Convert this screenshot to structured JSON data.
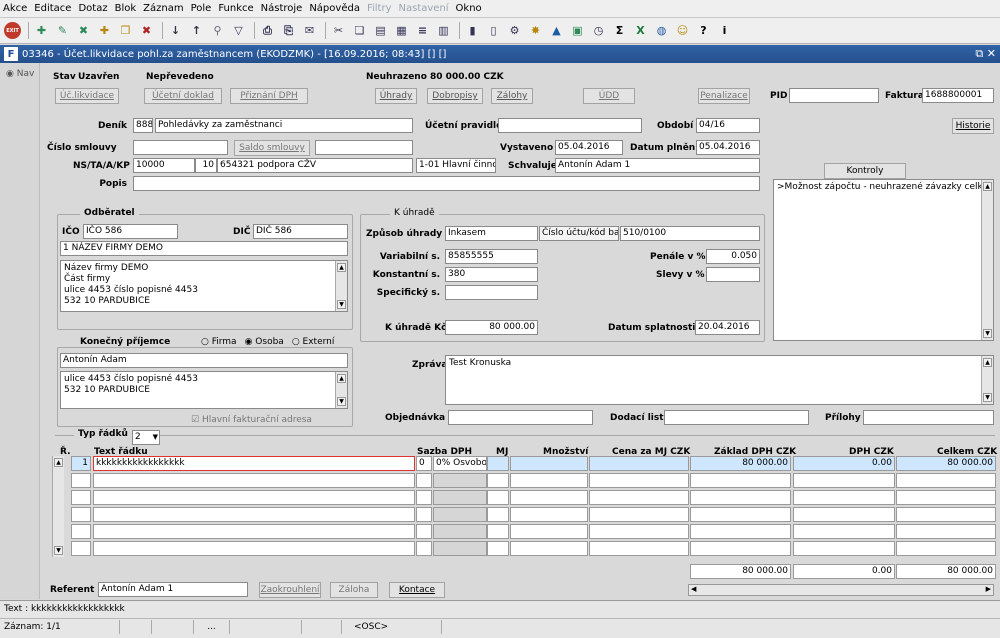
{
  "menu": [
    "Akce",
    "Editace",
    "Dotaz",
    "Blok",
    "Záznam",
    "Pole",
    "Funkce",
    "Nástroje",
    "Nápověda",
    "Filtry",
    "Nastavení",
    "Okno"
  ],
  "menu_disabled": [
    false,
    false,
    false,
    false,
    false,
    false,
    false,
    false,
    false,
    true,
    true,
    false
  ],
  "toolbar": [
    "exit-icon",
    "insert-icon",
    "save-icon",
    "delete-icon",
    "add-record-icon",
    "copy-record-icon",
    "remove-record-icon",
    "sort-asc-icon",
    "sort-desc-icon",
    "search-icon",
    "filter-icon",
    "print-icon",
    "print-preview-icon",
    "mail-icon",
    "cut-icon",
    "copy-icon",
    "paste-icon",
    "clipboard-icon",
    "align-icon",
    "grid-icon",
    "chart-icon",
    "document-icon",
    "settings-icon",
    "star-icon",
    "warning-icon",
    "calendar-icon",
    "clock-icon",
    "sum-icon",
    "excel-icon",
    "globe-icon",
    "users-icon",
    "help-icon",
    "info-icon"
  ],
  "window": {
    "title": "03346 - Účet.likvidace pohl.za zaměstnancem (EKODZMK) - [16.09.2016; 08:43] [] []",
    "controls": "⧉ ✕"
  },
  "nav": {
    "label": "Nav"
  },
  "header": {
    "stav_label": "Stav",
    "stav": "Uzavřen",
    "neprevedeno": "Nepřevedeno",
    "neuhrazeno": "Neuhrazeno  80 000.00 CZK"
  },
  "buttons": {
    "uc_likvidace": "Úč.likvidace",
    "ucetni_doklad": "Účetní doklad",
    "priznani_dph": "Přiznání DPH",
    "uhrady": "Úhrady",
    "dobropisy": "Dobropisy",
    "zalohy": "Zálohy",
    "udd": "ÚDD",
    "penalizace": "Penalizace",
    "historie": "Historie",
    "saldo_smlouvy": "Saldo smlouvy",
    "kontroly": "Kontroly",
    "zaokrouhleni": "Zaokrouhlení",
    "zalohab": "Záloha",
    "kontace": "Kontace"
  },
  "labels": {
    "pid": "PID",
    "faktura": "Faktura",
    "denik": "Deník",
    "ucetni_pravidlo": "Účetní pravidlo",
    "obdobi": "Období",
    "cislo_smlouvy": "Číslo smlouvy",
    "vystaveno": "Vystaveno",
    "datum_plneni": "Datum plnění",
    "ns": "NS/TA/A/KP",
    "schvaluje": "Schvaluje",
    "popis": "Popis",
    "odberatel": "Odběratel",
    "ico": "IČO",
    "dic": "DIČ",
    "k_uhrade": "K úhradě",
    "zpusob_uhrady": "Způsob úhrady",
    "cislo_uctu": "Číslo účtu/kód bar",
    "variabilni": "Variabilní s.",
    "konstantni": "Konstantní s.",
    "specificky": "Specifický s.",
    "penale": "Penále v %",
    "slevy": "Slevy v %",
    "k_uhrade_kc": "K úhradě Kč",
    "datum_splatnosti": "Datum splatnosti",
    "konecny_prijemce": "Konečný příjemce",
    "firma": "Firma",
    "osoba": "Osoba",
    "externi": "Externí",
    "zprava": "Zpráva",
    "objednavka": "Objednávka",
    "dodaci_list": "Dodací list",
    "prilohy": "Přílohy",
    "hlavni_adresa": "Hlavní fakturační adresa",
    "typ_radku": "Typ řádků",
    "referent": "Referent"
  },
  "fields": {
    "pid": "",
    "faktura": "1688800001",
    "denik_code": "888",
    "denik_name": "Pohledávky za zaměstnanci",
    "ucetni_pravidlo": "",
    "obdobi": "04/16",
    "cislo_smlouvy": "",
    "saldo_field": "",
    "vystaveno": "05.04.2016",
    "datum_plneni": "05.04.2016",
    "ns1": "10000",
    "ns2": "10",
    "ns3": "654321 podpora CŽV",
    "ns4": "1-01 Hlavní činnost",
    "schvaluje": "Antonín Adam 1",
    "popis": "",
    "ico": "IČO 586",
    "dic": "DIČ 586",
    "firma_name": "1 NÁZEV FIRMY DEMO",
    "address": [
      "Název firmy DEMO",
      "Část firmy",
      "ulice 4453 číslo popisné 4453",
      "532 10 PARDUBICE"
    ],
    "zpusob_uhrady": "Inkasem",
    "cislo_uctu": "510/0100",
    "variabilni": "85855555",
    "konstantni": "380",
    "specificky": "",
    "penale": "0.050",
    "slevy": "",
    "k_uhrade_kc": "80 000.00",
    "datum_splatnosti": "20.04.2016",
    "kontroly_text": ">Možnost zápočtu - neuhrazené závazky celkem",
    "prijemce_name": "Antonín Adam",
    "prijemce_address": [
      "ulice 4453 číslo popisné 4453",
      "532 10 PARDUBICE"
    ],
    "zprava": "Test Kronuska",
    "objednavka": "",
    "dodaci_list": "",
    "prilohy": "",
    "typ_radku": "2",
    "referent": "Antonín Adam 1"
  },
  "grid": {
    "headers": [
      "Ř.",
      "Text řádku",
      "Sazba DPH",
      "MJ",
      "Množství",
      "Cena za MJ CZK",
      "Základ DPH CZK",
      "DPH CZK",
      "Celkem CZK"
    ],
    "row1": {
      "r": "1",
      "text": "kkkkkkkkkkkkkkkkk",
      "sazba_code": "0",
      "sazba": "0% Osvobo",
      "mj": "",
      "mnozstvi": "",
      "cena": "",
      "zaklad": "80 000.00",
      "dph": "0.00",
      "celkem": "80 000.00"
    },
    "totals": {
      "zaklad": "80 000.00",
      "dph": "0.00",
      "celkem": "80 000.00"
    }
  },
  "status": {
    "line1": "Text : kkkkkkkkkkkkkkkkkk",
    "zaznam": "Záznam: 1/1",
    "dots": "...",
    "osc": "<OSC>"
  }
}
